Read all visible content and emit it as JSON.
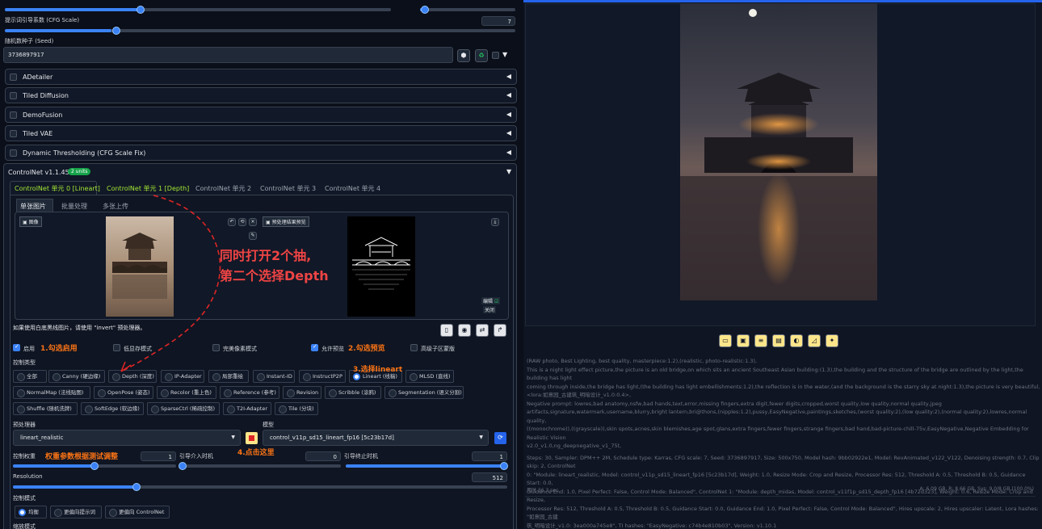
{
  "left": {
    "cfg": {
      "label": "提示词引导系数 (CFG Scale)",
      "value": "7",
      "fraction": 0.22
    },
    "seed": {
      "label": "随机数种子 (Seed)",
      "value": "3736897917"
    },
    "accordions": [
      "ADetailer",
      "Tiled Diffusion",
      "DemoFusion",
      "Tiled VAE",
      "Dynamic Thresholding (CFG Scale Fix)"
    ],
    "controlnet": {
      "title": "ControlNet v1.1.455",
      "badge": "2 units",
      "unit_tabs": [
        "ControlNet 单元 0 [Lineart]",
        "ControlNet 单元 1 [Depth]",
        "ControlNet 单元 2",
        "ControlNet 单元 3",
        "ControlNet 单元 4"
      ],
      "sub_tabs": [
        "单张图片",
        "批量处理",
        "多张上传"
      ],
      "image_label": "图像",
      "preview_label": "预处理结果预览",
      "edit_label": "编辑",
      "close_label": "关闭",
      "hint": "如果使用白底黑线图片，请使用 \"invert\" 预处理器。",
      "options": {
        "enable": "启用",
        "lowvram": "低显存模式",
        "pixel_perfect": "完美像素模式",
        "allow_preview": "允许预览",
        "upload_mask": "高级子区蒙版"
      },
      "control_type_label": "控制类型",
      "control_types_row1": [
        "全部",
        "Canny (硬边缘)",
        "Depth (深度)",
        "IP-Adapter",
        "局部重绘",
        "Instant-ID",
        "InstructP2P",
        "Lineart (线稿)",
        "MLSD (直线)"
      ],
      "control_types_row2": [
        "NormalMap (法线贴图)",
        "OpenPose (姿态)",
        "Recolor (重上色)",
        "Reference (参考)",
        "Revision",
        "Scribble (涂鸦)",
        "Segmentation (语义分割)"
      ],
      "control_types_row3": [
        "Shuffle (随机洗牌)",
        "SoftEdge (软边缘)",
        "SparseCtrl (稀疏控制)",
        "T2I-Adapter",
        "Tile (分块)"
      ],
      "preprocessor_label": "预处理器",
      "preprocessor": "lineart_realistic",
      "model_label": "模型",
      "model": "control_v11p_sd15_lineart_fp16 [5c23b17d]",
      "weight": {
        "label": "控制权重",
        "value": "1",
        "fraction": 0.5
      },
      "start": {
        "label": "引导介入时机",
        "value": "0",
        "fraction": 0.0
      },
      "end": {
        "label": "引导终止时机",
        "value": "1",
        "fraction": 1.0
      },
      "resolution": {
        "label": "Resolution",
        "value": "512",
        "fraction": 0.25
      },
      "control_mode_label": "控制模式",
      "control_modes": [
        "均衡",
        "更偏向提示词",
        "更偏向 ControlNet"
      ],
      "resize_label": "缩放模式"
    },
    "annotations": {
      "big": "同时打开2个抽,",
      "big2": "第二个选择Depth",
      "a1": "1.勾选启用",
      "a2": "2.勾选预览",
      "a3": "3.选择lineart",
      "a4": "4.点击这里",
      "a5": "权重参数根据测试调整"
    }
  },
  "right": {
    "toolbar_icons": [
      "folder-icon",
      "save-icon",
      "zip-icon",
      "image-icon",
      "palette-icon",
      "ruler-icon",
      "sparkle-icon"
    ],
    "info_lines": [
      "(RAW photo, Best Lighting, best quality, masterpiece:1.2),(realistic, photo-realistic:1.3),",
      "This is a night light effect picture,the picture is an old bridge,on which sits an ancient Southeast Asian building:(1.3),the building and the structure of the bridge are outlined by the light,the building has light",
      "coming through inside,the bridge has light,(the building has light embellishments:1.2),the reflection is in the water,(and the background is the starry sky at night:1.3),the picture is very beautiful,",
      "<lora:如意园_古建筑_明暗设计_v1.0:0.4>,",
      "Negative prompt: lowres,bad anatomy,nsfw,bad hands,text,error,missing fingers,extra digit,fewer digits,cropped,worst quality,low quality,normal quality,jpeg",
      "artifacts,signature,watermark,username,blurry,bright lantern,bri@thons,(nipples:1.2),pussy,EasyNegative,paintings,sketches,(worst quality:2),(low quality:2),(normal quality:2),lowres,normal quality,",
      "((monochrome)),((grayscale)),skin spots,acnes,skin blemishes,age spot,glans,extra fingers,fewer fingers,strange fingers,bad hand,bad-picture-chill-75v,EasyNegative,Negative Embedding for Realistic Vision",
      "v2.0_v1.0,ng_deepnegative_v1_75t,",
      "Steps: 30, Sampler: DPM++ 2M, Schedule type: Karras, CFG scale: 7, Seed: 3736897917, Size: 500x750, Model hash: 9bb02922e1, Model: RevAnimated_v122_V122, Denoising strength: 0.7, Clip skip: 2, ControlNet",
      "0: \"Module: lineart_realistic, Model: control_v11p_sd15_lineart_fp16 [5c23b17d], Weight: 1.0, Resize Mode: Crop and Resize, Processor Res: 512, Threshold A: 0.5, Threshold B: 0.5, Guidance Start: 0.0,",
      "Guidance End: 1.0, Pixel Perfect: False, Control Mode: Balanced\", ControlNet 1: \"Module: depth_midas, Model: control_v11f1p_sd15_depth_fp16 [4b72d323], Weight: 0.6, Resize Mode: Crop and Resize,",
      "Processor Res: 512, Threshold A: 0.5, Threshold B: 0.5, Guidance Start: 0.0, Guidance End: 1.0, Pixel Perfect: False, Control Mode: Balanced\", Hires upscale: 2, Hires upscaler: Latent, Lora hashes: \"如意园_古建",
      "筑_明暗设计_v1.0: 3ea000a745e8\", TI hashes: \"EasyNegative: c74b4e810b03\", Version: v1.10.1"
    ],
    "time": "用时 36.3 sec.",
    "vram": "A: 6.09 GB, R: 8.66 GB, Sys: 9.0/8 GB (100.0%)"
  }
}
